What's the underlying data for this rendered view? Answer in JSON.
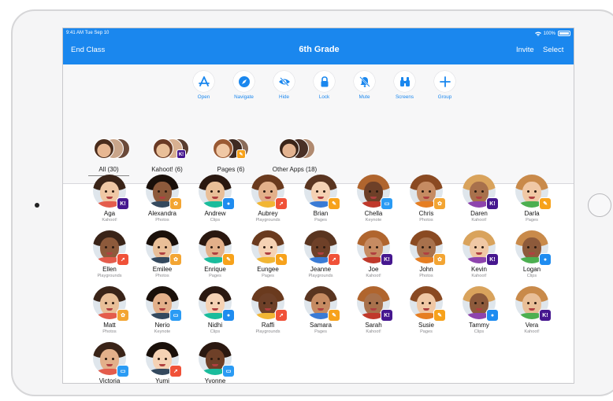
{
  "status": {
    "time": "9:41 AM  Tue Sep 10",
    "battery": "100%"
  },
  "nav": {
    "end_class": "End Class",
    "title": "6th Grade",
    "invite": "Invite",
    "select": "Select"
  },
  "actions": [
    {
      "label": "Open",
      "icon": "app-store-icon"
    },
    {
      "label": "Navigate",
      "icon": "compass-icon"
    },
    {
      "label": "Hide",
      "icon": "eye-slash-icon"
    },
    {
      "label": "Lock",
      "icon": "lock-icon"
    },
    {
      "label": "Mute",
      "icon": "bell-slash-icon"
    },
    {
      "label": "Screens",
      "icon": "binoculars-icon"
    },
    {
      "label": "Group",
      "icon": "plus-icon"
    }
  ],
  "filters": [
    {
      "label": "All (30)",
      "badge": ""
    },
    {
      "label": "Kahoot! (6)",
      "badge": "kahoot"
    },
    {
      "label": "Pages (6)",
      "badge": "pages"
    },
    {
      "label": "Other Apps (18)",
      "badge": ""
    }
  ],
  "app_colors": {
    "kahoot": "#46178f",
    "photos": "#f3a533",
    "clips": "#1f8cf0",
    "playgrounds": "#f05138",
    "pages": "#f7a21b",
    "keynote": "#2a9bf4"
  },
  "students": [
    {
      "name": "Aga",
      "app": "Kahoot!",
      "badge": "kahoot"
    },
    {
      "name": "Alexandra",
      "app": "Photos",
      "badge": "photos"
    },
    {
      "name": "Andrew",
      "app": "Clips",
      "badge": "clips"
    },
    {
      "name": "Aubrey",
      "app": "Playgrounds",
      "badge": "playgrounds"
    },
    {
      "name": "Brian",
      "app": "Pages",
      "badge": "pages"
    },
    {
      "name": "Chella",
      "app": "Keynote",
      "badge": "keynote"
    },
    {
      "name": "Chris",
      "app": "Photos",
      "badge": "photos"
    },
    {
      "name": "Daren",
      "app": "Kahoot!",
      "badge": "kahoot"
    },
    {
      "name": "Darla",
      "app": "Pages",
      "badge": "pages"
    },
    {
      "name": "Ellen",
      "app": "Playgrounds",
      "badge": "playgrounds"
    },
    {
      "name": "Emilee",
      "app": "Photos",
      "badge": "photos"
    },
    {
      "name": "Enrique",
      "app": "Pages",
      "badge": "pages"
    },
    {
      "name": "Eungee",
      "app": "Pages",
      "badge": "pages"
    },
    {
      "name": "Jeanne",
      "app": "Playgrounds",
      "badge": "playgrounds"
    },
    {
      "name": "Joe",
      "app": "Kahoot!",
      "badge": "kahoot"
    },
    {
      "name": "John",
      "app": "Photos",
      "badge": "photos"
    },
    {
      "name": "Kevin",
      "app": "Kahoot!",
      "badge": "kahoot"
    },
    {
      "name": "Logan",
      "app": "Clips",
      "badge": "clips"
    },
    {
      "name": "Matt",
      "app": "Photos",
      "badge": "photos"
    },
    {
      "name": "Nerio",
      "app": "Keynote",
      "badge": "keynote"
    },
    {
      "name": "Nidhi",
      "app": "Clips",
      "badge": "clips"
    },
    {
      "name": "Raffi",
      "app": "Playgrounds",
      "badge": "playgrounds"
    },
    {
      "name": "Samara",
      "app": "Pages",
      "badge": "pages"
    },
    {
      "name": "Sarah",
      "app": "Kahoot!",
      "badge": "kahoot"
    },
    {
      "name": "Susie",
      "app": "Pages",
      "badge": "pages"
    },
    {
      "name": "Tammy",
      "app": "Clips",
      "badge": "clips"
    },
    {
      "name": "Vera",
      "app": "Kahoot!",
      "badge": "kahoot"
    },
    {
      "name": "Victoria",
      "app": "",
      "badge": "keynote"
    },
    {
      "name": "Yumi",
      "app": "",
      "badge": "playgrounds"
    },
    {
      "name": "Yvonne",
      "app": "",
      "badge": "keynote"
    }
  ]
}
